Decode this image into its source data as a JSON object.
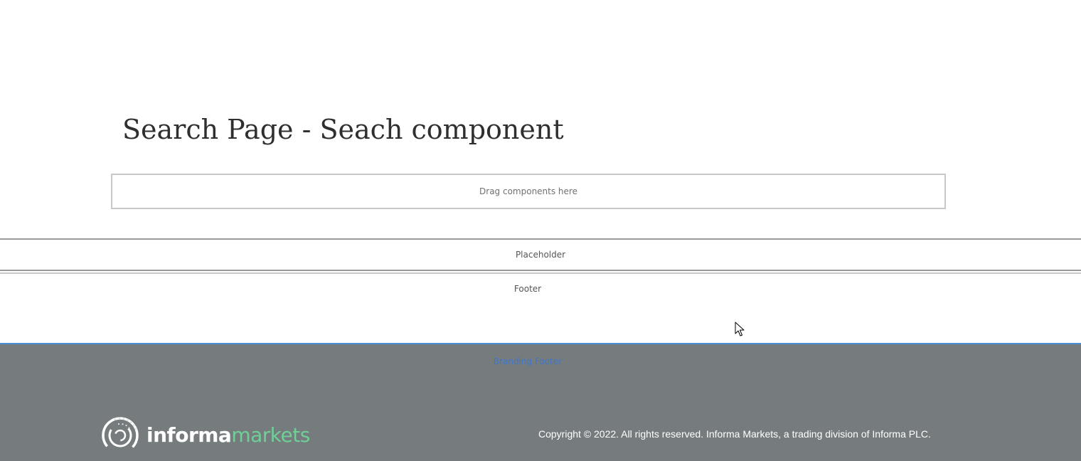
{
  "page": {
    "title": "Search Page - Seach component"
  },
  "dropzone": {
    "label": "Drag components here"
  },
  "placeholder": {
    "label": "Placeholder"
  },
  "footer": {
    "label": "Footer"
  },
  "branding_footer": {
    "label": "Branding Footer",
    "logo": {
      "word1": "informa",
      "word2": "markets"
    },
    "copyright": "Copyright © 2022. All rights reserved. Informa Markets, a trading division of Informa PLC."
  },
  "colors": {
    "footer_bg": "#767c7e",
    "footer_accent": "#4a8fd6",
    "logo_green": "#6fcf97"
  },
  "icons": {
    "logo_mark": "informa-ring-logo-icon",
    "cursor": "mouse-pointer-icon"
  }
}
